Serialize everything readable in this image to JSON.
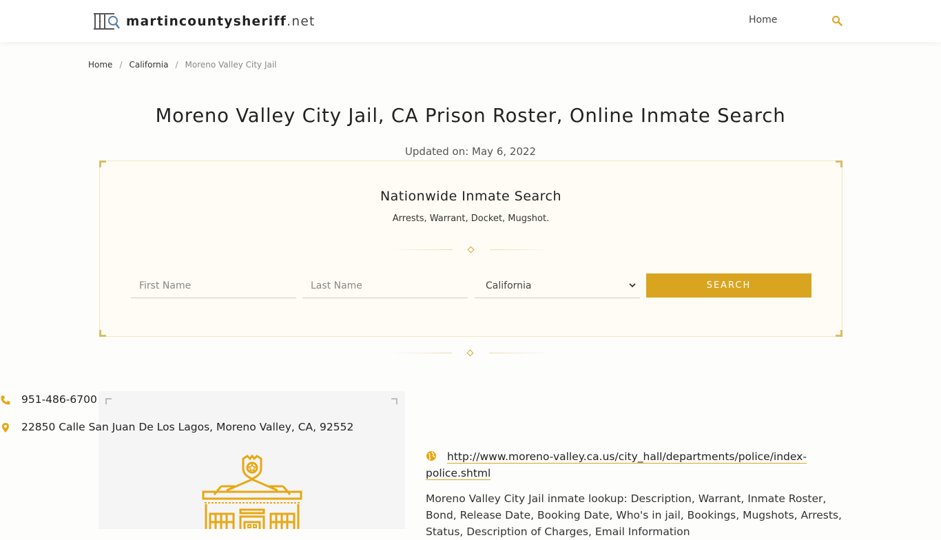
{
  "header": {
    "logo_main": "martincountysheriff",
    "logo_tld": ".net",
    "nav_home": "Home",
    "search_icon": "search-icon"
  },
  "breadcrumb": {
    "items": [
      "Home",
      "California",
      "Moreno Valley City Jail"
    ],
    "separator": "/"
  },
  "page": {
    "title": "Moreno Valley City Jail, CA Prison Roster, Online Inmate Search",
    "updated": "Updated on: May 6, 2022"
  },
  "search_box": {
    "title": "Nationwide Inmate Search",
    "subtitle": "Arrests, Warrant, Docket, Mugshot.",
    "first_name_placeholder": "First Name",
    "last_name_placeholder": "Last Name",
    "first_name_value": "",
    "last_name_value": "",
    "state_selected": "California",
    "search_label": "SEARCH"
  },
  "facility": {
    "image_icon": "jail-building-icon",
    "phone": "951-486-6700",
    "address": "22850 Calle San Juan De Los Lagos, Moreno Valley, CA, 92552",
    "website": "http://www.moreno-valley.ca.us/city_hall/departments/police/index-police.shtml",
    "description": "Moreno Valley City Jail inmate lookup: Description, Warrant, Inmate Roster, Bond, Release Date, Booking Date, Who's in jail, Bookings, Mugshots, Arrests, Status, Description of Charges, Email Information"
  },
  "colors": {
    "accent": "#d9a521",
    "search_box_bg": "#fefcf4",
    "image_panel_bg": "#f5f5f5"
  }
}
